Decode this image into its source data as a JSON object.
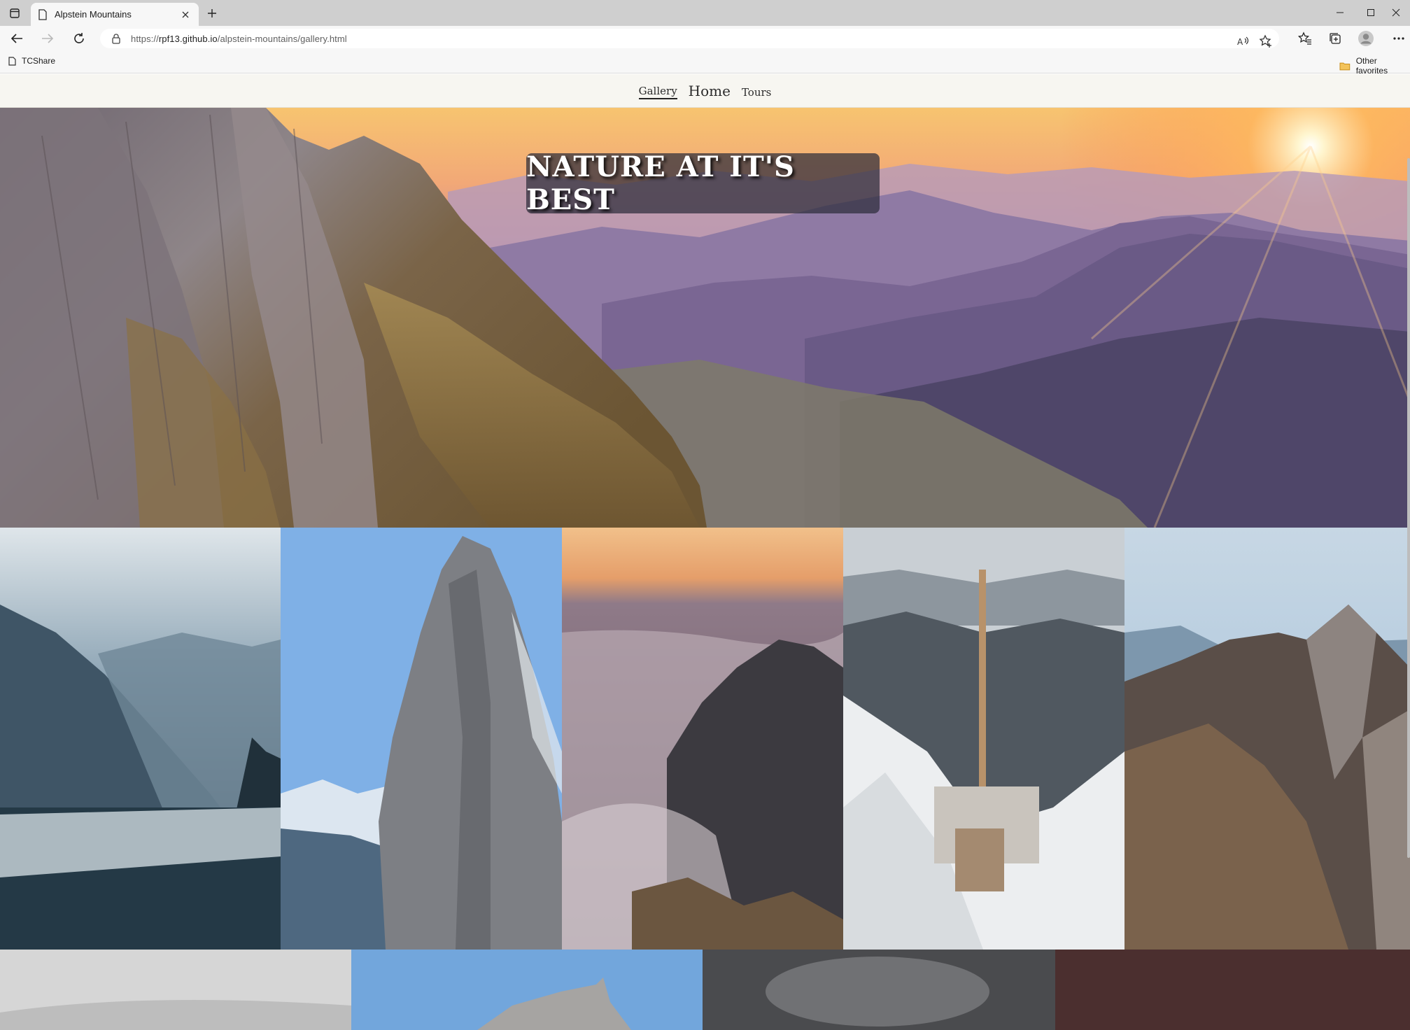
{
  "browser": {
    "tab_title": "Alpstein Mountains",
    "url_prefix": "https://",
    "url_host": "rpf13.github.io",
    "url_path": "/alpstein-mountains/gallery.html",
    "favorites": [
      {
        "label": "TCShare",
        "icon": "page-icon"
      },
      {
        "label": "Other favorites",
        "icon": "folder-icon"
      }
    ]
  },
  "site": {
    "nav": [
      {
        "label": "Gallery",
        "state": "active"
      },
      {
        "label": "Home",
        "state": "large"
      },
      {
        "label": "Tours",
        "state": "normal"
      }
    ],
    "hero_title": "NATURE AT IT'S BEST"
  },
  "gallery": {
    "row1": [
      {
        "subject": "misty lake in a valley",
        "colors": [
          "#c9d6df",
          "#4d6b7f",
          "#1c2a35"
        ]
      },
      {
        "subject": "rocky peak against blue sky",
        "colors": [
          "#8fb4e0",
          "#7a7c80",
          "#3d4046"
        ]
      },
      {
        "subject": "peak above a sea of clouds at sunset",
        "colors": [
          "#e7a36b",
          "#7e6f7d",
          "#3a3337"
        ]
      },
      {
        "subject": "snowy summit with antenna tower",
        "colors": [
          "#cfd4d8",
          "#e6e8ea",
          "#3b3f45"
        ]
      },
      {
        "subject": "rugged mountain ridge",
        "colors": [
          "#a7c4dc",
          "#6a5e56",
          "#3a322d"
        ]
      }
    ],
    "row2": [
      {
        "subject": "foggy slope",
        "colors": [
          "#dadada",
          "#b5b5b5"
        ]
      },
      {
        "subject": "rock pinnacle in blue sky",
        "colors": [
          "#6fa3d9",
          "#8bb7e2"
        ]
      },
      {
        "subject": "dark storm clouds",
        "colors": [
          "#444548",
          "#7a7b7e"
        ]
      },
      {
        "subject": "reddish brown tones",
        "colors": [
          "#4b2f2f",
          "#5e3a38"
        ]
      }
    ]
  }
}
